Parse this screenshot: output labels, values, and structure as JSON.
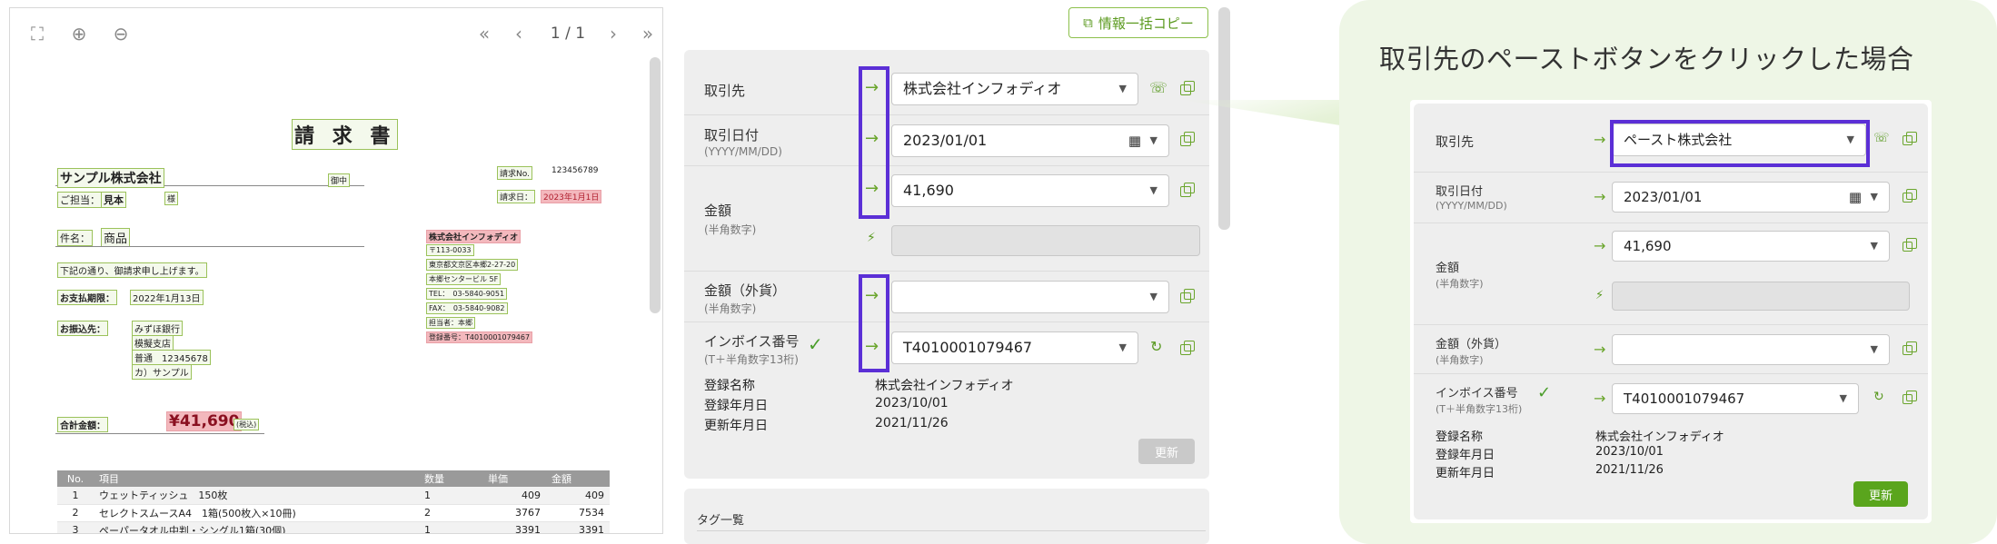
{
  "pdf_viewer": {
    "page_indicator": "1 / 1",
    "toolbar_icons": [
      "fullscreen-icon",
      "zoom-in-icon",
      "zoom-out-icon",
      "first-page-icon",
      "prev-page-icon",
      "next-page-icon",
      "last-page-icon"
    ]
  },
  "invoice": {
    "title": "請 求 書",
    "client_name": "サンプル株式会社",
    "honorific": "御中",
    "contact_label": "ご担当：",
    "contact_name": "見本",
    "contact_suffix": "様",
    "subject_label": "件名：",
    "subject": "商品",
    "message": "下記の通り、御請求申し上げます。",
    "due_label": "お支払期限：",
    "due_date": "2022年1月13日",
    "bank_label": "お振込先：",
    "bank_lines": [
      "みずほ銀行",
      "模擬支店",
      "普通　12345678",
      "カ）サンプル"
    ],
    "invoice_no_label": "請求No.",
    "invoice_no": "123456789",
    "invoice_date_label": "請求日：",
    "invoice_date": "2023年1月1日",
    "issuer_lines": [
      "株式会社インフォディオ",
      "〒113-0033",
      "東京都文京区本郷2-27-20",
      "本郷センタービル 5F",
      "TEL：　03-5840-9051",
      "FAX：　03-5840-9082",
      "担当者：本郷",
      "登録番号：T4010001079467"
    ],
    "total_label": "合計金額：",
    "total": "¥41,690",
    "tax_note": "(税込)",
    "table_headers": [
      "No.",
      "項目",
      "数量",
      "単価",
      "金額"
    ],
    "rows": [
      {
        "no": "1",
        "item": "ウェットティッシュ　150枚",
        "qty": "1",
        "price": "409",
        "amount": "409"
      },
      {
        "no": "2",
        "item": "セレクトスムースA4　1箱(500枚入×10冊)",
        "qty": "2",
        "price": "3767",
        "amount": "7534"
      },
      {
        "no": "3",
        "item": "ペーパータオル中判・シングル1箱(30個)",
        "qty": "1",
        "price": "3391",
        "amount": "3391"
      }
    ]
  },
  "form": {
    "copy_all_button": "情報一括コピー",
    "fields": {
      "partner_label": "取引先",
      "partner_value": "株式会社インフォディオ",
      "date_label": "取引日付",
      "date_sub": "(YYYY/MM/DD)",
      "date_value": "2023/01/01",
      "amount_label": "金額",
      "amount_sub": "(半角数字)",
      "amount_value": "41,690",
      "foreign_label": "金額（外貨）",
      "foreign_sub": "(半角数字)",
      "invoice_no_label": "インボイス番号",
      "invoice_no_sub": "(T＋半角数字13桁)",
      "invoice_no_value": "T4010001079467"
    },
    "info": {
      "reg_name_label": "登録名称",
      "reg_name_value": "株式会社インフォディオ",
      "reg_date_label": "登録年月日",
      "reg_date_value": "2023/10/01",
      "upd_date_label": "更新年月日",
      "upd_date_value": "2021/11/26"
    },
    "update_button": "更新",
    "tag_section_title": "タグ一覧"
  },
  "callout": {
    "title": "取引先のペーストボタンをクリックした場合",
    "partner_value": "ペースト株式会社",
    "update_button": "更新"
  },
  "colors": {
    "accent_green": "#6aa52c",
    "highlight_purple": "#5b2fd6",
    "update_active": "#5aa51d",
    "update_disabled": "#c9c9c9",
    "callout_bg": "#eef6e6"
  }
}
